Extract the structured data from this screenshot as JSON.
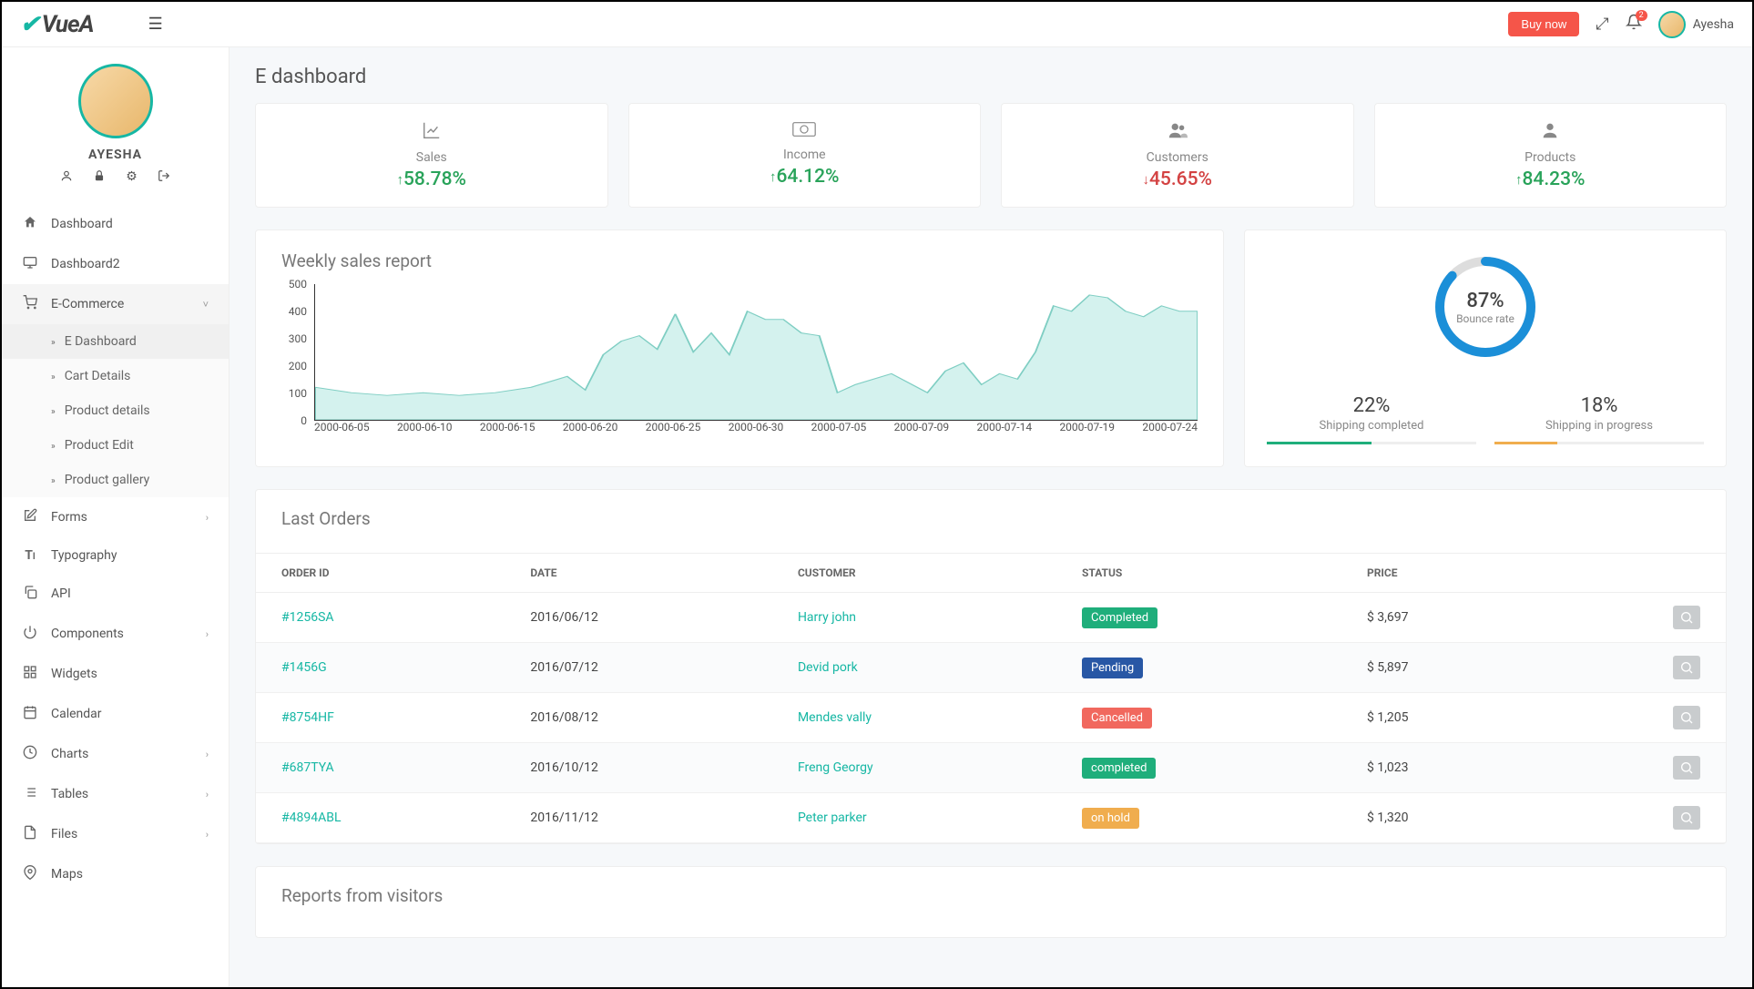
{
  "brand": "VueA",
  "top": {
    "buy": "Buy now",
    "notif_count": "2",
    "user": "Ayesha"
  },
  "profile": {
    "name": "AYESHA"
  },
  "sidebar": {
    "items": [
      {
        "icon": "home",
        "label": "Dashboard",
        "chev": false
      },
      {
        "icon": "monitor",
        "label": "Dashboard2",
        "chev": false
      },
      {
        "icon": "cart",
        "label": "E-Commerce",
        "chev": true,
        "active": true
      },
      {
        "icon": "edit",
        "label": "Forms",
        "chev": true
      },
      {
        "icon": "type",
        "label": "Typography",
        "chev": false
      },
      {
        "icon": "copy",
        "label": "API",
        "chev": false
      },
      {
        "icon": "power",
        "label": "Components",
        "chev": true
      },
      {
        "icon": "grid",
        "label": "Widgets",
        "chev": false
      },
      {
        "icon": "cal",
        "label": "Calendar",
        "chev": false
      },
      {
        "icon": "clock",
        "label": "Charts",
        "chev": true
      },
      {
        "icon": "list",
        "label": "Tables",
        "chev": true
      },
      {
        "icon": "file",
        "label": "Files",
        "chev": true
      },
      {
        "icon": "pin",
        "label": "Maps",
        "chev": false
      }
    ],
    "ecommerce_sub": [
      "E Dashboard",
      "Cart Details",
      "Product details",
      "Product Edit",
      "Product gallery"
    ]
  },
  "page": {
    "title": "E dashboard"
  },
  "stats": [
    {
      "icon": "chart",
      "label": "Sales",
      "value": "58.78%",
      "dir": "up"
    },
    {
      "icon": "cash",
      "label": "Income",
      "value": "64.12%",
      "dir": "up"
    },
    {
      "icon": "users",
      "label": "Customers",
      "value": "45.65%",
      "dir": "down"
    },
    {
      "icon": "user",
      "label": "Products",
      "value": "84.23%",
      "dir": "up"
    }
  ],
  "weekly": {
    "title": "Weekly sales report"
  },
  "bounce": {
    "pct": "87%",
    "label": "Bounce rate",
    "ship": [
      {
        "pct": "22%",
        "label": "Shipping completed",
        "color": "#1fae7b",
        "width": "50%"
      },
      {
        "pct": "18%",
        "label": "Shipping in progress",
        "color": "#f0ad4e",
        "width": "30%"
      }
    ]
  },
  "orders": {
    "title": "Last Orders",
    "cols": [
      "ORDER ID",
      "DATE",
      "CUSTOMER",
      "STATUS",
      "PRICE"
    ],
    "rows": [
      {
        "id": "#1256SA",
        "date": "2016/06/12",
        "cust": "Harry john",
        "status": "Completed",
        "scls": "completed",
        "price": "$ 3,697"
      },
      {
        "id": "#1456G",
        "date": "2016/07/12",
        "cust": "Devid pork",
        "status": "Pending",
        "scls": "pending",
        "price": "$ 5,897"
      },
      {
        "id": "#8754HF",
        "date": "2016/08/12",
        "cust": "Mendes vally",
        "status": "Cancelled",
        "scls": "cancelled",
        "price": "$ 1,205"
      },
      {
        "id": "#687TYA",
        "date": "2016/10/12",
        "cust": "Freng Georgy",
        "status": "completed",
        "scls": "completed",
        "price": "$ 1,023"
      },
      {
        "id": "#4894ABL",
        "date": "2016/11/12",
        "cust": "Peter parker",
        "status": "on hold",
        "scls": "onhold",
        "price": "$ 1,320"
      }
    ]
  },
  "reports": {
    "title": "Reports from visitors"
  },
  "chart_data": {
    "type": "area",
    "title": "Weekly sales report",
    "xlabel": "",
    "ylabel": "",
    "ylim": [
      0,
      500
    ],
    "yticks": [
      0,
      100,
      200,
      300,
      400,
      500
    ],
    "xticks": [
      "2000-06-05",
      "2000-06-10",
      "2000-06-15",
      "2000-06-20",
      "2000-06-25",
      "2000-06-30",
      "2000-07-05",
      "2000-07-09",
      "2000-07-14",
      "2000-07-19",
      "2000-07-24"
    ],
    "x_days_since_start": [
      0,
      5,
      10,
      15,
      20,
      25,
      30,
      34,
      39,
      44,
      49
    ],
    "series": [
      {
        "name": "sales",
        "values_at_ticks": [
          120,
          100,
          130,
          110,
          390,
          370,
          120,
          100,
          150,
          450,
          400
        ]
      }
    ],
    "dense": {
      "x": [
        0,
        2,
        4,
        6,
        8,
        10,
        12,
        14,
        15,
        16,
        17,
        18,
        19,
        20,
        21,
        22,
        23,
        24,
        25,
        26,
        27,
        28,
        29,
        30,
        32,
        34,
        35,
        36,
        37,
        38,
        39,
        40,
        41,
        42,
        43,
        44,
        45,
        46,
        47,
        48,
        49
      ],
      "y": [
        120,
        100,
        90,
        100,
        90,
        100,
        120,
        160,
        110,
        240,
        290,
        310,
        260,
        390,
        250,
        320,
        240,
        400,
        370,
        370,
        320,
        310,
        100,
        130,
        170,
        100,
        180,
        210,
        130,
        170,
        150,
        250,
        420,
        400,
        460,
        450,
        400,
        380,
        420,
        400,
        400
      ]
    }
  }
}
